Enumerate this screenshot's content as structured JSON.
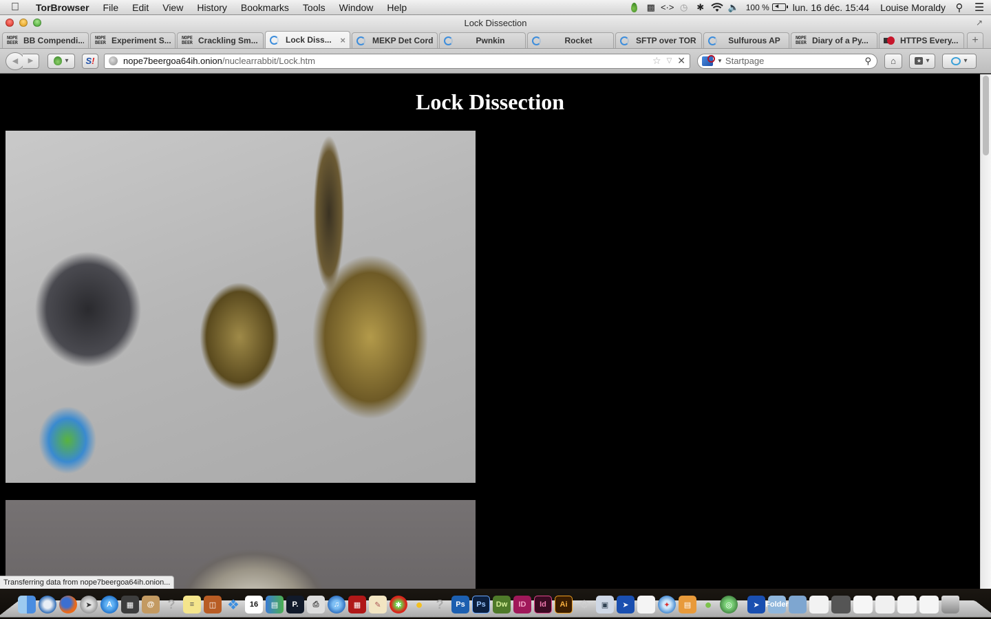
{
  "menubar": {
    "apple_icon": "apple-logo",
    "app_name": "TorBrowser",
    "menus": [
      "File",
      "Edit",
      "View",
      "History",
      "Bookmarks",
      "Tools",
      "Window",
      "Help"
    ],
    "status": {
      "battery_percent": "100 %",
      "datetime": "lun. 16 déc.  15:44",
      "user": "Louise Moraldy"
    }
  },
  "window": {
    "title": "Lock Dissection"
  },
  "tabs": [
    {
      "label": "BB Compendi...",
      "icon": "nope-beer",
      "active": false
    },
    {
      "label": "Experiment S...",
      "icon": "nope-beer",
      "active": false
    },
    {
      "label": "Crackling Sm...",
      "icon": "nope-beer",
      "active": false
    },
    {
      "label": "Lock Diss...",
      "icon": "loading-spinner",
      "active": true
    },
    {
      "label": "MEKP Det Cord",
      "icon": "loading-spinner",
      "active": false
    },
    {
      "label": "Pwnkin",
      "icon": "loading-spinner",
      "active": false
    },
    {
      "label": "Rocket",
      "icon": "loading-spinner",
      "active": false
    },
    {
      "label": "SFTP over TOR",
      "icon": "loading-spinner",
      "active": false
    },
    {
      "label": "Sulfurous AP",
      "icon": "loading-spinner",
      "active": false
    },
    {
      "label": "Diary of a Py...",
      "icon": "nope-beer",
      "active": false
    },
    {
      "label": "HTTPS Every...",
      "icon": "https-everywhere",
      "active": false
    }
  ],
  "nope_beer_text": [
    "NOPE",
    "BEER"
  ],
  "tab_close_glyph": "×",
  "new_tab_glyph": "+",
  "navbar": {
    "url_host": "nope7beergoa64ih.onion",
    "url_path": "/nuclearrabbit/Lock.htm",
    "search_placeholder": "Startpage",
    "s_button_label": "S",
    "s_button_bang": "!"
  },
  "page": {
    "heading": "Lock Dissection",
    "images": [
      {
        "description": "Disassembled brass deadbolt lock next to a keyring on concrete"
      },
      {
        "description": "Close-up of brass lock cylinder on grey background"
      }
    ]
  },
  "status_message": "Transferring data from nope7beergoa64ih.onion...",
  "dock": {
    "apps": [
      "Finder",
      "Thunderbird",
      "Firefox",
      "Launchpad",
      "App Store",
      "Image Capture",
      "Contacts",
      "Unknown",
      "Stickies",
      "Keynote",
      "Dropbox",
      "Calendar",
      "Numbers",
      "Pixelmator",
      "Printer",
      "iTunes",
      "Photo Booth",
      "TextEdit",
      "Tomato",
      "Cyberduck",
      "Unknown",
      "Photoshop",
      "Photoshop",
      "Dreamweaver",
      "InDesign",
      "InDesign",
      "Illustrator",
      "Automator",
      "Preview",
      "Vuze",
      "Document",
      "Safari",
      "Archive Utility",
      "Tor Browser",
      "Globe"
    ],
    "calendar_day": "16",
    "labels": {
      "ps": "Ps",
      "dw": "Dw",
      "id_a": "ID",
      "id_b": "Id",
      "ai": "Ai",
      "pix": "P.",
      "q": "?"
    },
    "folders": [
      "Folder",
      "Folder"
    ],
    "minimized_windows": 6,
    "trash": "Trash"
  }
}
